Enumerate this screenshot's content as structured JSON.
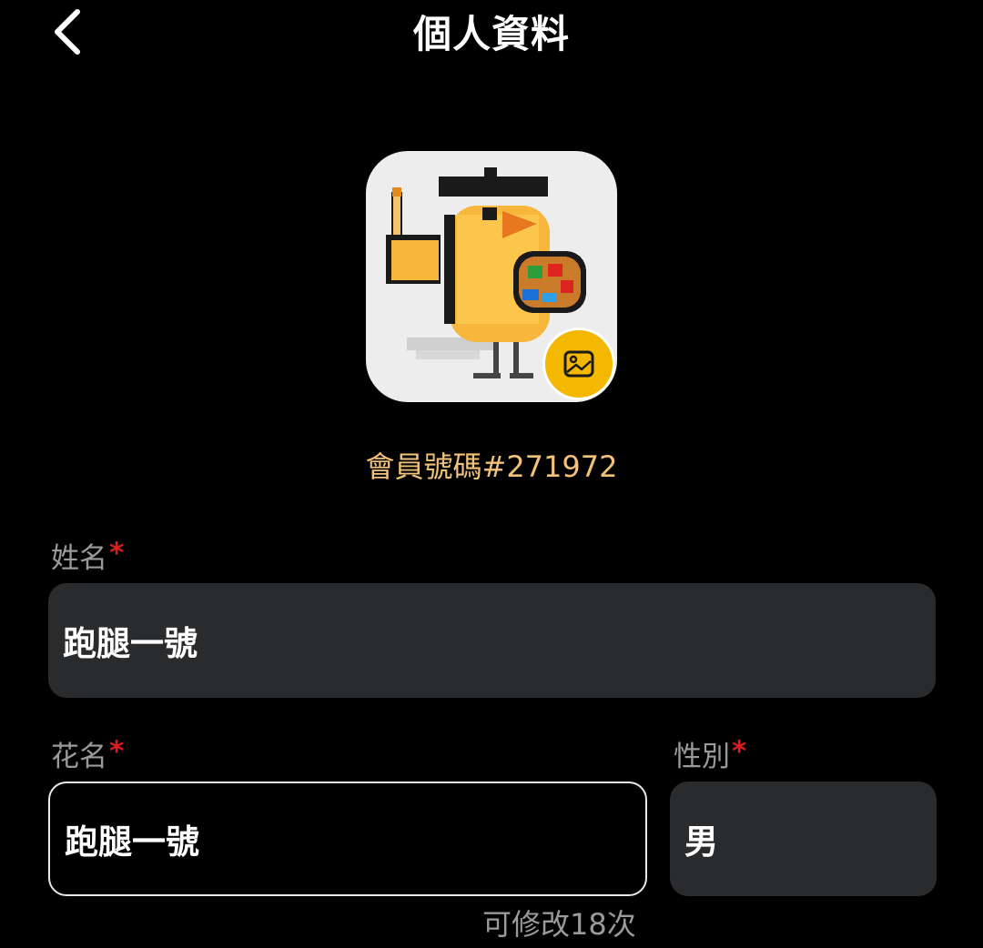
{
  "header": {
    "title": "個人資料",
    "back_icon": "chevron-left-icon"
  },
  "profile": {
    "avatar_icon": "pixel-bird-painter-avatar",
    "edit_icon": "image-icon",
    "member_id": "會員號碼#271972"
  },
  "form": {
    "name": {
      "label": "姓名",
      "required_mark": "*",
      "value": "跑腿一號"
    },
    "nickname": {
      "label": "花名",
      "required_mark": "*",
      "value": "跑腿一號",
      "helper": "可修改18次"
    },
    "gender": {
      "label": "性別",
      "required_mark": "*",
      "value": "男"
    }
  },
  "colors": {
    "background": "#000000",
    "accent": "#f5b800",
    "member_id": "#f2c27a",
    "field_fill": "#2a2b2d",
    "required": "#d81e1e",
    "label": "#9a9a9a"
  }
}
